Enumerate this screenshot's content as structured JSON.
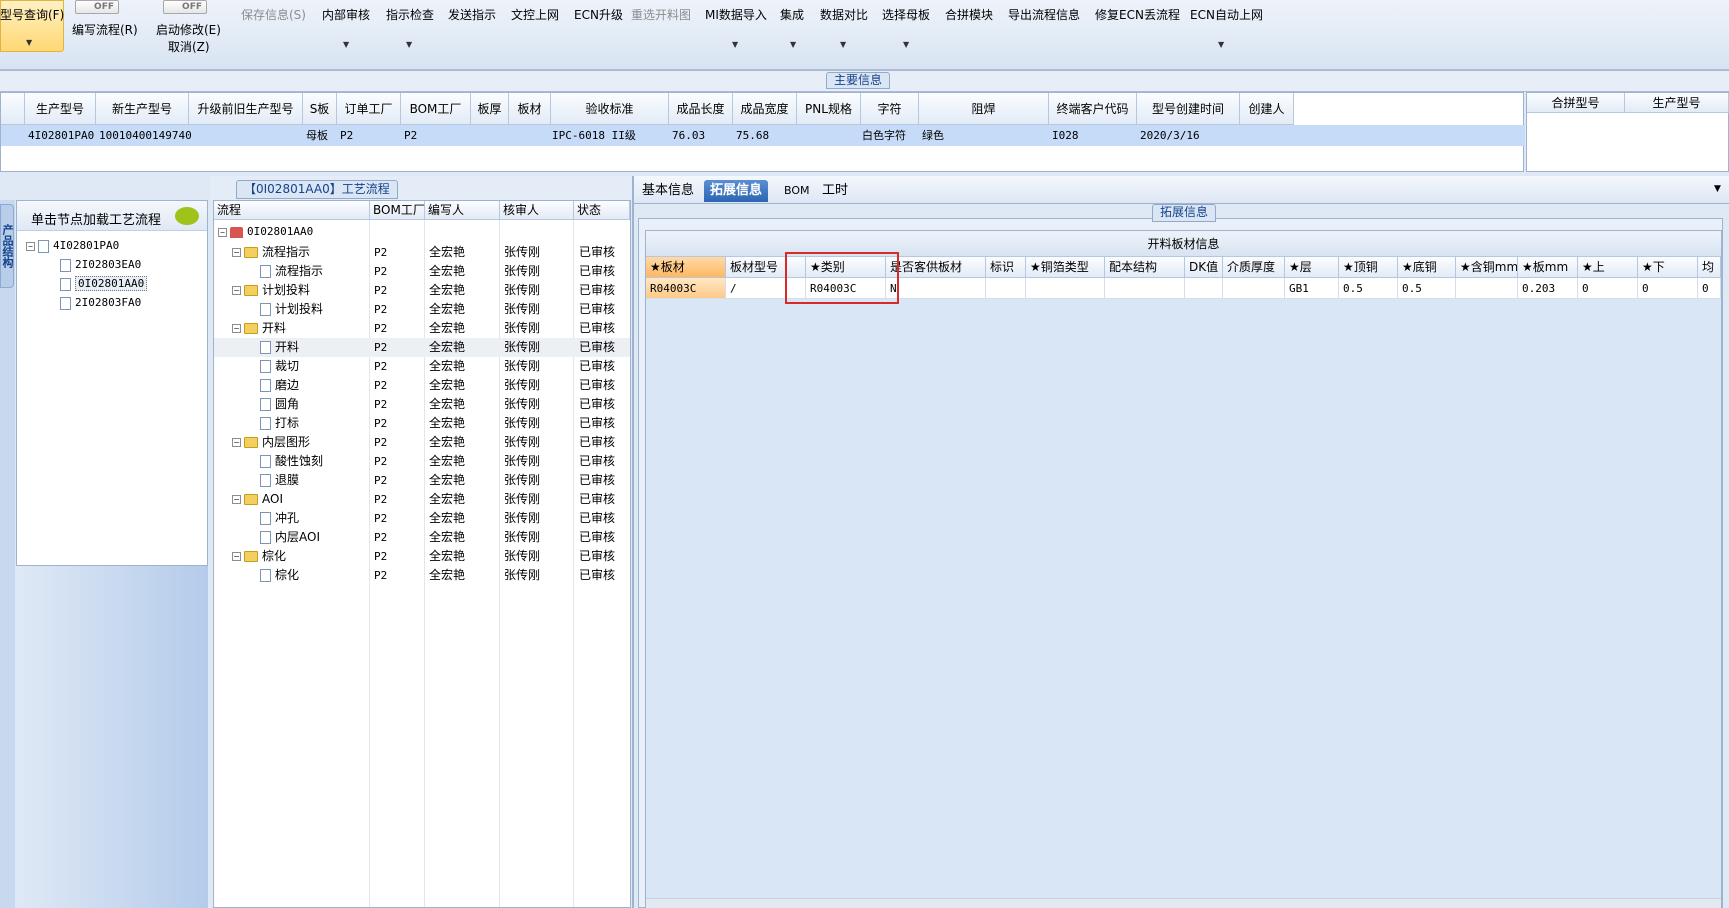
{
  "toolbar": {
    "buttons": [
      {
        "label": "型号查询(F)"
      },
      {
        "label": "编写流程(R)"
      },
      {
        "label": "启动修改(E)"
      },
      {
        "label": "取消(Z)"
      },
      {
        "label": "保存信息(S)"
      },
      {
        "label": "内部审核"
      },
      {
        "label": "指示检查"
      },
      {
        "label": "发送指示"
      },
      {
        "label": "文控上网"
      },
      {
        "label": "ECN升级"
      },
      {
        "label": "重选开料图"
      },
      {
        "label": "MI数据导入"
      },
      {
        "label": "集成"
      },
      {
        "label": "数据对比"
      },
      {
        "label": "选择母板"
      },
      {
        "label": "合拼模块"
      },
      {
        "label": "导出流程信息"
      },
      {
        "label": "修复ECN丢流程"
      },
      {
        "label": "ECN自动上网"
      }
    ],
    "switch1": "OFF",
    "switch2": "OFF",
    "dropdown_glyph": "▼"
  },
  "main_info": {
    "title": "主要信息",
    "headers": [
      "生产型号",
      "新生产型号",
      "升级前旧生产型号",
      "S板",
      "订单工厂",
      "BOM工厂",
      "板厚",
      "板材",
      "验收标准",
      "成品长度",
      "成品宽度",
      "PNL规格",
      "字符",
      "阻焊",
      "终端客户代码",
      "型号创建时间",
      "创建人"
    ],
    "row": {
      "prod_no": "4I02801PA0",
      "new_prod_no": "10010400149740",
      "s_board": "母板",
      "order_factory": "P2",
      "bom_factory": "P2",
      "standard": "IPC-6018 II级",
      "length": "76.03",
      "width": "75.68",
      "char": "白色字符",
      "mask": "绿色",
      "customer": "I028",
      "created": "2020/3/16"
    },
    "merge_headers": [
      "合拼型号",
      "生产型号"
    ]
  },
  "left_panel": {
    "vertical_tab": "产品结构",
    "header": "单击节点加载工艺流程",
    "tree": [
      {
        "label": "4I02801PA0",
        "level": 0
      },
      {
        "label": "2I02803EA0",
        "level": 1
      },
      {
        "label": "0I02801AA0",
        "level": 1
      },
      {
        "label": "2I02803FA0",
        "level": 1
      }
    ]
  },
  "process": {
    "tab_title": "【0I02801AA0】工艺流程",
    "headers": [
      "流程",
      "BOM工厂",
      "编写人",
      "核审人",
      "状态"
    ],
    "root": "0I02801AA0",
    "rows": [
      {
        "name": "流程指示",
        "bom": "P2",
        "writer": "全宏艳",
        "reviewer": "张传刚",
        "status": "已审核",
        "type": "folder"
      },
      {
        "name": "流程指示",
        "bom": "P2",
        "writer": "全宏艳",
        "reviewer": "张传刚",
        "status": "已审核",
        "type": "doc"
      },
      {
        "name": "计划投料",
        "bom": "P2",
        "writer": "全宏艳",
        "reviewer": "张传刚",
        "status": "已审核",
        "type": "folder"
      },
      {
        "name": "计划投料",
        "bom": "P2",
        "writer": "全宏艳",
        "reviewer": "张传刚",
        "status": "已审核",
        "type": "doc"
      },
      {
        "name": "开料",
        "bom": "P2",
        "writer": "全宏艳",
        "reviewer": "张传刚",
        "status": "已审核",
        "type": "folder"
      },
      {
        "name": "开料",
        "bom": "P2",
        "writer": "全宏艳",
        "reviewer": "张传刚",
        "status": "已审核",
        "type": "doc"
      },
      {
        "name": "裁切",
        "bom": "P2",
        "writer": "全宏艳",
        "reviewer": "张传刚",
        "status": "已审核",
        "type": "doc"
      },
      {
        "name": "磨边",
        "bom": "P2",
        "writer": "全宏艳",
        "reviewer": "张传刚",
        "status": "已审核",
        "type": "doc"
      },
      {
        "name": "圆角",
        "bom": "P2",
        "writer": "全宏艳",
        "reviewer": "张传刚",
        "status": "已审核",
        "type": "doc"
      },
      {
        "name": "打标",
        "bom": "P2",
        "writer": "全宏艳",
        "reviewer": "张传刚",
        "status": "已审核",
        "type": "doc"
      },
      {
        "name": "内层图形",
        "bom": "P2",
        "writer": "全宏艳",
        "reviewer": "张传刚",
        "status": "已审核",
        "type": "folder"
      },
      {
        "name": "酸性蚀刻",
        "bom": "P2",
        "writer": "全宏艳",
        "reviewer": "张传刚",
        "status": "已审核",
        "type": "doc"
      },
      {
        "name": "退膜",
        "bom": "P2",
        "writer": "全宏艳",
        "reviewer": "张传刚",
        "status": "已审核",
        "type": "doc"
      },
      {
        "name": "AOI",
        "bom": "P2",
        "writer": "全宏艳",
        "reviewer": "张传刚",
        "status": "已审核",
        "type": "folder"
      },
      {
        "name": "冲孔",
        "bom": "P2",
        "writer": "全宏艳",
        "reviewer": "张传刚",
        "status": "已审核",
        "type": "doc"
      },
      {
        "name": "内层AOI",
        "bom": "P2",
        "writer": "全宏艳",
        "reviewer": "张传刚",
        "status": "已审核",
        "type": "doc"
      },
      {
        "name": "棕化",
        "bom": "P2",
        "writer": "全宏艳",
        "reviewer": "张传刚",
        "status": "已审核",
        "type": "folder"
      },
      {
        "name": "棕化",
        "bom": "P2",
        "writer": "全宏艳",
        "reviewer": "张传刚",
        "status": "已审核",
        "type": "doc"
      }
    ]
  },
  "right_panel": {
    "tabs": [
      "基本信息",
      "拓展信息",
      "BOM",
      "工时"
    ],
    "group_title": "拓展信息",
    "grid_title": "开料板材信息",
    "headers": [
      "★板材",
      "板材型号",
      "★类别",
      "是否客供板材",
      "标识",
      "★铜箔类型",
      "配本结构",
      "DK值",
      "介质厚度",
      "★层",
      "★顶铜",
      "★底铜",
      "★含铜mm",
      "★板mm",
      "★上",
      "★下",
      "均"
    ],
    "row": [
      "R04003C",
      "/",
      "R04003C",
      "N",
      "",
      "",
      "",
      "",
      "",
      "GB1",
      "0.5",
      "0.5",
      "",
      "0.203",
      "0",
      "0",
      "0"
    ]
  }
}
